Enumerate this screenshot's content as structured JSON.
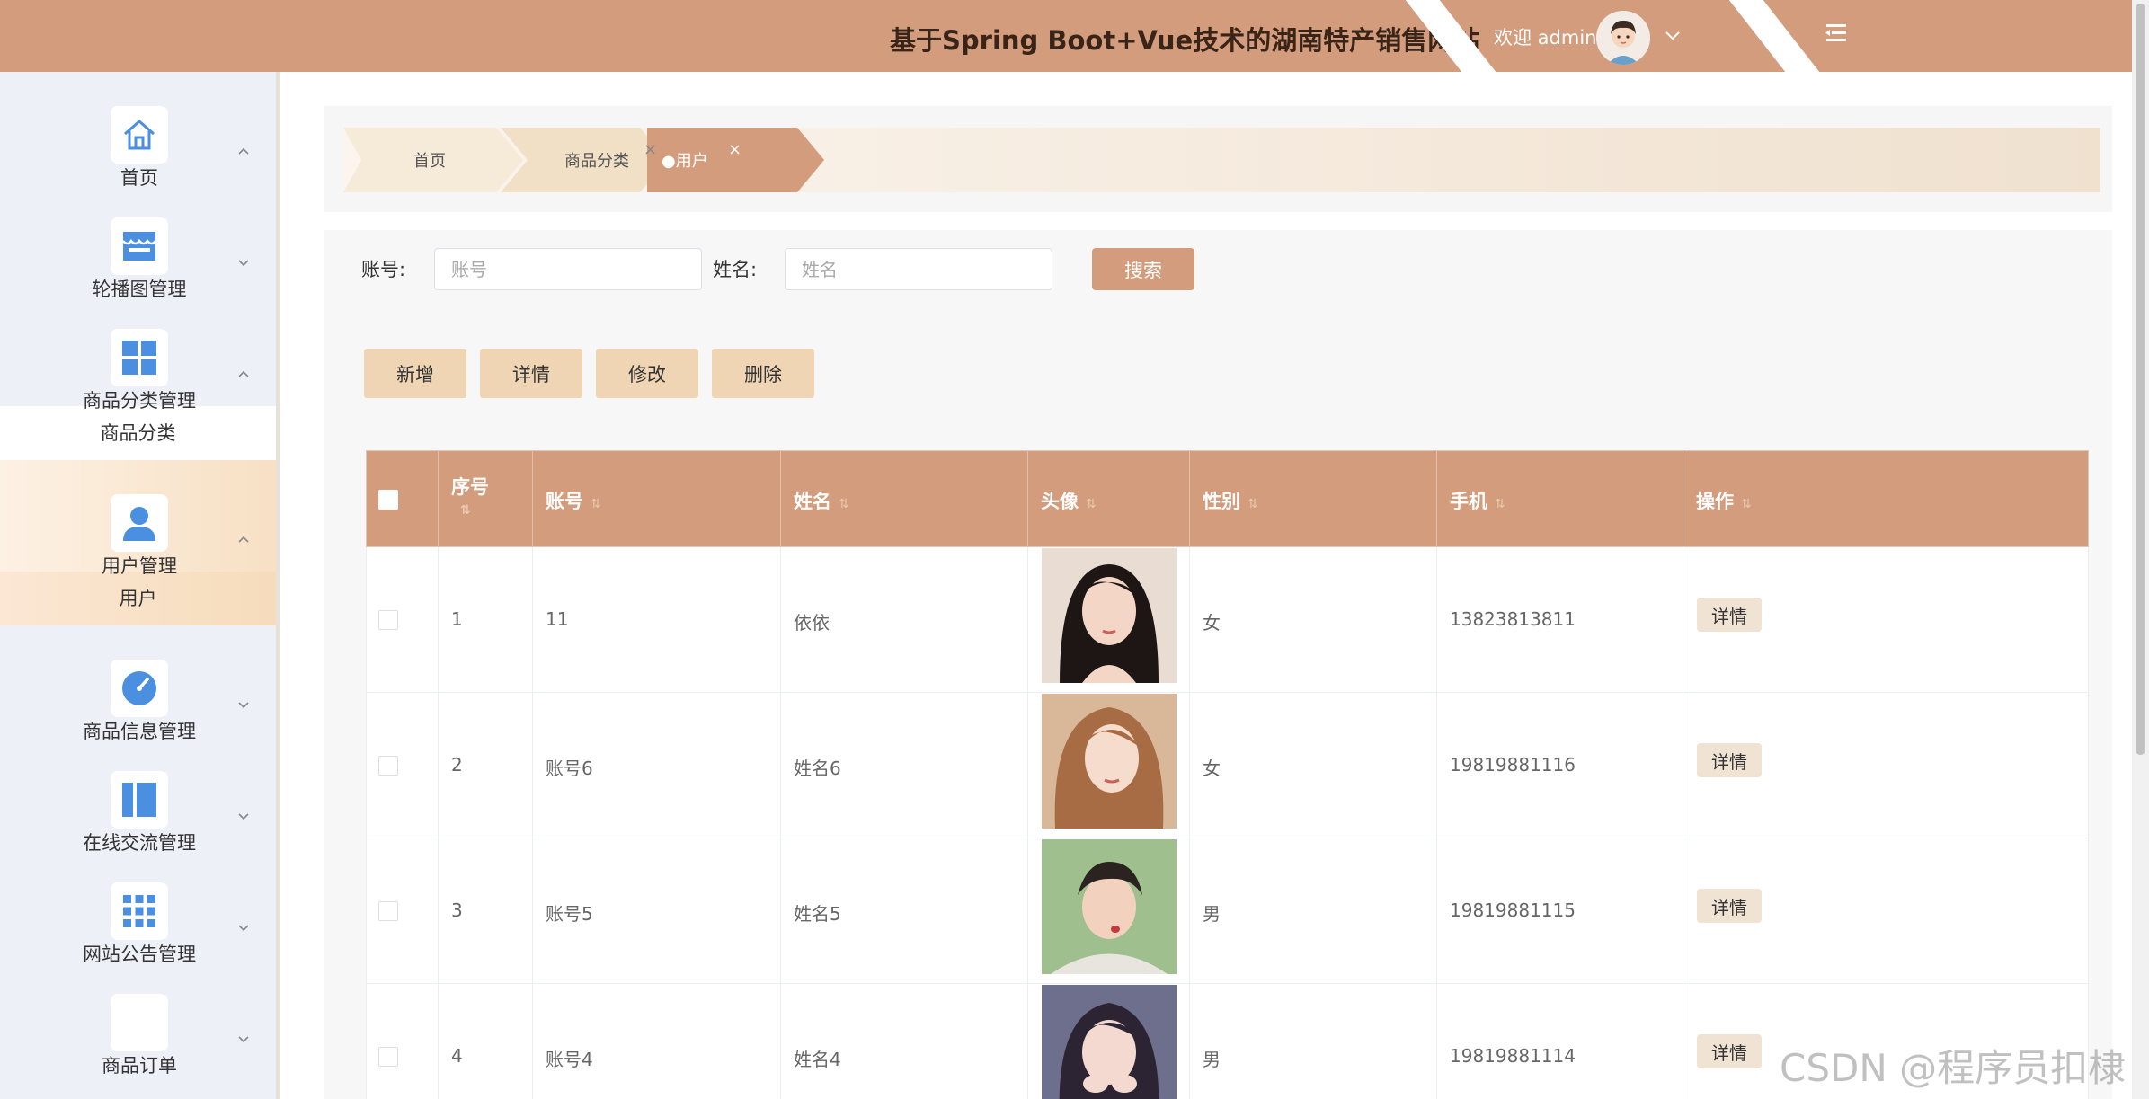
{
  "header": {
    "title": "基于Spring Boot+Vue技术的湖南特产销售网站",
    "welcome": "欢迎 admin"
  },
  "sidebar": {
    "items": [
      {
        "label": "首页",
        "icon": "home-icon",
        "icon_color": "#4a8fe0",
        "expanded": true
      },
      {
        "label": "轮播图管理",
        "icon": "store-icon",
        "icon_color": "#4a8fe0",
        "expanded": false
      },
      {
        "label": "商品分类管理",
        "icon": "grid-icon",
        "icon_color": "#4a8fe0",
        "expanded": true,
        "children": [
          "商品分类"
        ]
      },
      {
        "label": "用户管理",
        "icon": "user-icon",
        "icon_color": "#4a8fe0",
        "expanded": true,
        "active": true,
        "children": [
          "用户"
        ]
      },
      {
        "label": "商品信息管理",
        "icon": "gauge-icon",
        "icon_color": "#4a8fe0",
        "expanded": false
      },
      {
        "label": "在线交流管理",
        "icon": "panel-icon",
        "icon_color": "#4a8fe0",
        "expanded": false
      },
      {
        "label": "网站公告管理",
        "icon": "apps-icon",
        "icon_color": "#4a8fe0",
        "expanded": false
      },
      {
        "label": "商品订单",
        "icon": "blank-icon",
        "expanded": false
      }
    ]
  },
  "breadcrumbs": [
    {
      "label": "首页"
    },
    {
      "label": "商品分类",
      "closable": true
    },
    {
      "label": "●用户",
      "closable": true,
      "active": true
    }
  ],
  "close_glyph": "×",
  "filter": {
    "account_label": "账号:",
    "account_placeholder": "账号",
    "name_label": "姓名:",
    "name_placeholder": "姓名",
    "search_label": "搜索"
  },
  "actions": {
    "add": "新增",
    "detail": "详情",
    "edit": "修改",
    "delete": "删除"
  },
  "sort_glyph": "⇅",
  "table": {
    "headers": [
      "序号",
      "账号",
      "姓名",
      "头像",
      "性别",
      "手机",
      "操作"
    ],
    "row_action": "详情",
    "rows": [
      {
        "index": "1",
        "account": "11",
        "name": "依依",
        "gender": "女",
        "phone": "13823813811"
      },
      {
        "index": "2",
        "account": "账号6",
        "name": "姓名6",
        "gender": "女",
        "phone": "19819881116"
      },
      {
        "index": "3",
        "account": "账号5",
        "name": "姓名5",
        "gender": "男",
        "phone": "19819881115"
      },
      {
        "index": "4",
        "account": "账号4",
        "name": "姓名4",
        "gender": "男",
        "phone": "19819881114"
      }
    ]
  },
  "watermark": "CSDN @程序员扣棣",
  "colors": {
    "primary": "#d39c7c",
    "action_button": "#f0d5b4",
    "sidebar_bg": "#eef0f8",
    "icon_blue": "#4a8fe0"
  }
}
